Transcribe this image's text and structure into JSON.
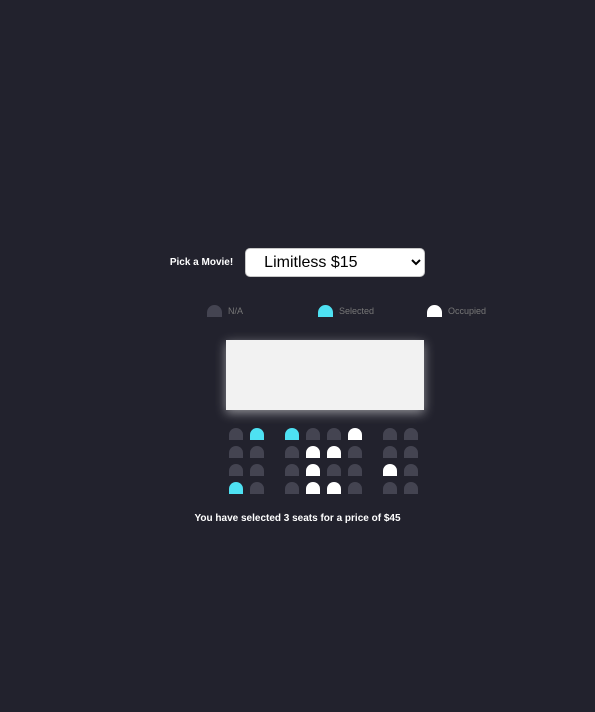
{
  "movie_picker": {
    "label": "Pick a Movie!",
    "selected": "Limitless $15"
  },
  "legend": {
    "na": "N/A",
    "selected": "Selected",
    "occupied": "Occupied"
  },
  "seat_map": [
    [
      "na",
      "selected",
      "selected",
      "na",
      "na",
      "occupied",
      "na",
      "na"
    ],
    [
      "na",
      "na",
      "na",
      "occupied",
      "occupied",
      "na",
      "na",
      "na"
    ],
    [
      "na",
      "na",
      "na",
      "occupied",
      "na",
      "na",
      "occupied",
      "na"
    ],
    [
      "selected",
      "na",
      "na",
      "occupied",
      "occupied",
      "na",
      "na",
      "na"
    ]
  ],
  "summary": {
    "prefix": "You have selected ",
    "count": "3",
    "middle": " seats for a price of $",
    "total": "45"
  },
  "colors": {
    "background": "#22222d",
    "seat_na": "#444451",
    "seat_selected": "#4ee1f2",
    "seat_occupied": "#ffffff",
    "screen": "#f2f2f2"
  }
}
